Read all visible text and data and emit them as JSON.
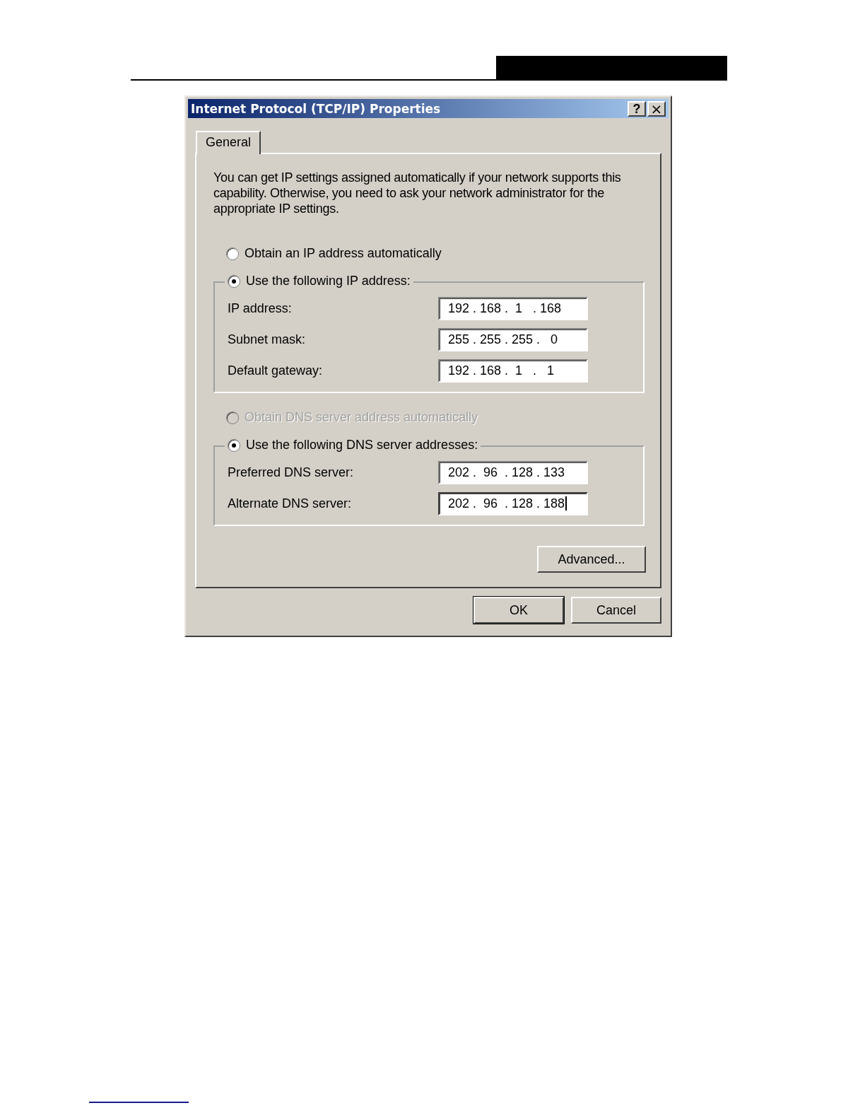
{
  "window": {
    "title": "Internet Protocol (TCP/IP) Properties",
    "buttons": [
      {
        "kind": "help",
        "label": "?"
      },
      {
        "kind": "close",
        "label": "×"
      }
    ]
  },
  "tabs": [
    {
      "label": "General",
      "selected": true
    }
  ],
  "intro": "You can get IP settings assigned automatically if your network supports this capability. Otherwise, you need to ask your network administrator for the appropriate IP settings.",
  "sections": [
    {
      "options": [
        {
          "label": "Obtain an IP address automatically",
          "selected": false,
          "disabled": false
        },
        {
          "label": "Use the following IP address:",
          "selected": true,
          "disabled": false
        }
      ],
      "fields": [
        {
          "label": "IP address:",
          "value": "192 . 168 .  1   . 168",
          "focused": false
        },
        {
          "label": "Subnet mask:",
          "value": "255 . 255 . 255 .   0",
          "focused": false
        },
        {
          "label": "Default gateway:",
          "value": "192 . 168 .  1   .   1",
          "focused": false
        }
      ]
    },
    {
      "options": [
        {
          "label": "Obtain DNS server address automatically",
          "selected": false,
          "disabled": true
        },
        {
          "label": "Use the following DNS server addresses:",
          "selected": true,
          "disabled": false
        }
      ],
      "fields": [
        {
          "label": "Preferred DNS server:",
          "value": "202 .  96  . 128 . 133",
          "focused": false
        },
        {
          "label": "Alternate DNS server:",
          "value": "202 .  96  . 128 . 188",
          "focused": true
        }
      ]
    }
  ],
  "advanced_button": "Advanced...",
  "footer_buttons": [
    {
      "label": "OK",
      "default": true
    },
    {
      "label": "Cancel",
      "default": false
    }
  ]
}
